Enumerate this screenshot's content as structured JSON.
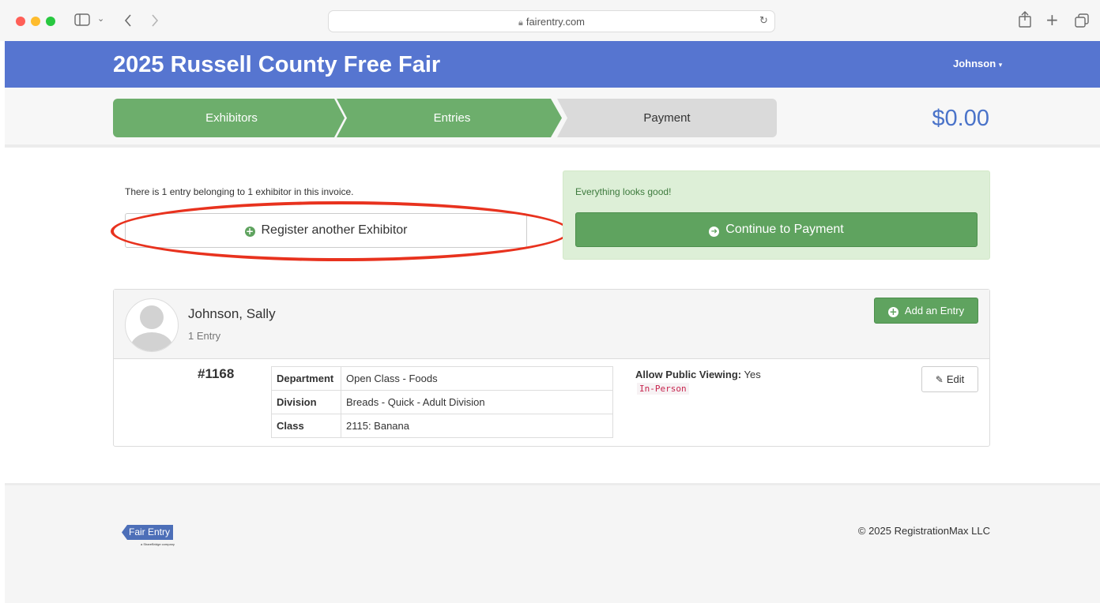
{
  "browser": {
    "url": "fairentry.com",
    "icons": [
      "close-dot",
      "minimize-dot",
      "zoom-dot",
      "sidebar-icon",
      "chevron-down-icon",
      "back-icon",
      "forward-icon",
      "lock-icon",
      "reload-icon",
      "share-icon",
      "new-tab-icon",
      "tabs-icon"
    ],
    "traffic_colors": [
      "#ff5f57",
      "#febc2e",
      "#28c840"
    ]
  },
  "header": {
    "title": "2025 Russell County Free Fair",
    "user": "Johnson",
    "user_caret": "▾",
    "brand_color": "#5675d0"
  },
  "steps": [
    {
      "label": "Exhibitors",
      "state": "complete"
    },
    {
      "label": "Entries",
      "state": "complete"
    },
    {
      "label": "Payment",
      "state": "pending"
    }
  ],
  "total": "$0.00",
  "invoice": {
    "summary": "There is 1 entry belonging to 1 exhibitor in this invoice.",
    "register_label": "Register another Exhibitor",
    "status": "Everything looks good!",
    "continue_label": "Continue to Payment"
  },
  "exhibitor": {
    "name": "Johnson, Sally",
    "entry_count": "1 Entry",
    "add_entry_label": "Add an Entry",
    "entry": {
      "number": "#1168",
      "details": [
        {
          "key": "Department",
          "value": "Open Class - Foods"
        },
        {
          "key": "Division",
          "value": "Breads - Quick - Adult Division"
        },
        {
          "key": "Class",
          "value": "2115: Banana"
        }
      ],
      "public_label": "Allow Public Viewing:",
      "public_value": "Yes",
      "delivery": "In-Person",
      "edit_label": "Edit"
    }
  },
  "footer": {
    "logo_text": "Fair Entry",
    "logo_sub": "a ShareBridge company",
    "copyright": "© 2025 RegistrationMax LLC"
  },
  "colors": {
    "success": "#5fa35f",
    "success_bg": "#ddefd7",
    "annotation": "#e8321e",
    "total": "#4a73c9"
  }
}
